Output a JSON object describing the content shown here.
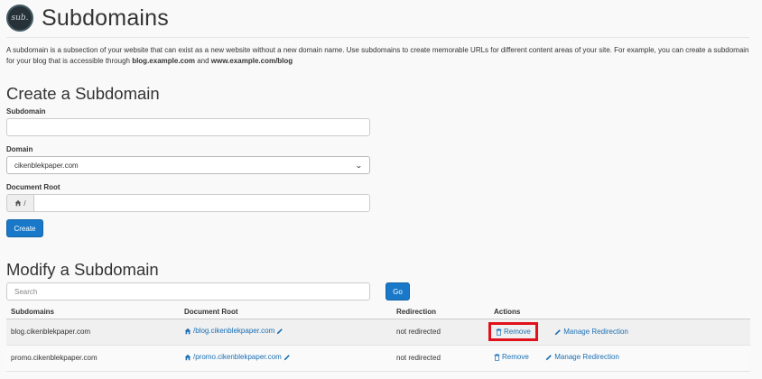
{
  "header": {
    "logo_text": "sub.",
    "title": "Subdomains"
  },
  "intro": {
    "text": "A subdomain is a subsection of your website that can exist as a new website without a new domain name. Use subdomains to create memorable URLs for different content areas of your site. For example, you can create a subdomain for your blog that is accessible through ",
    "example1": "blog.example.com",
    "and": " and ",
    "example2": "www.example.com/blog"
  },
  "create": {
    "title": "Create a Subdomain",
    "subdomain_label": "Subdomain",
    "subdomain_value": "",
    "domain_label": "Domain",
    "domain_selected": "cikenblekpaper.com",
    "docroot_label": "Document Root",
    "docroot_prefix": "/",
    "docroot_value": "",
    "button": "Create"
  },
  "modify": {
    "title": "Modify a Subdomain",
    "search_placeholder": "Search",
    "go_button": "Go",
    "columns": [
      "Subdomains",
      "Document Root",
      "Redirection",
      "Actions"
    ],
    "rows": [
      {
        "subdomain": "blog.cikenblekpaper.com",
        "docroot": "/blog.cikenblekpaper.com",
        "redirection": "not redirected",
        "remove": "Remove",
        "manage": "Manage Redirection"
      },
      {
        "subdomain": "promo.cikenblekpaper.com",
        "docroot": "/promo.cikenblekpaper.com",
        "redirection": "not redirected",
        "remove": "Remove",
        "manage": "Manage Redirection"
      }
    ]
  },
  "colors": {
    "primary": "#1978c8",
    "link": "#1a6fb5",
    "highlight": "#e0101c"
  },
  "icons": {
    "home": "home-icon",
    "pencil": "pencil-icon",
    "trash": "trash-icon"
  }
}
